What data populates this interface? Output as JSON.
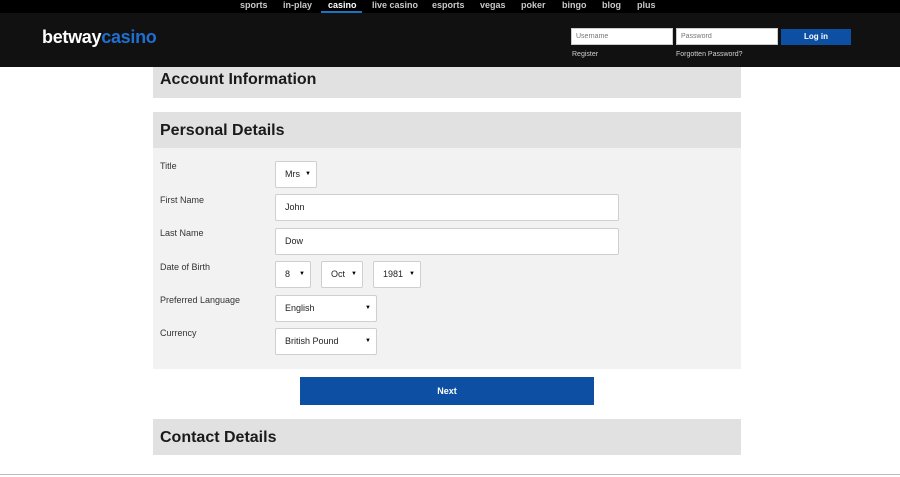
{
  "nav": {
    "items": [
      {
        "label": "sports",
        "active": false
      },
      {
        "label": "in-play",
        "active": false
      },
      {
        "label": "casino",
        "active": true
      },
      {
        "label": "live casino",
        "active": false
      },
      {
        "label": "esports",
        "active": false
      },
      {
        "label": "vegas",
        "active": false
      },
      {
        "label": "poker",
        "active": false
      },
      {
        "label": "bingo",
        "active": false
      },
      {
        "label": "blog",
        "active": false
      },
      {
        "label": "plus",
        "active": false
      }
    ]
  },
  "header": {
    "logo_part1": "betway",
    "logo_part2": "casino",
    "username_placeholder": "Username",
    "password_placeholder": "Password",
    "login_label": "Log in",
    "register_label": "Register",
    "forgotten_label": "Forgotten Password?"
  },
  "sections": {
    "account": "Account Information",
    "personal": "Personal Details",
    "contact": "Contact Details"
  },
  "form": {
    "title": {
      "label": "Title",
      "value": "Mrs"
    },
    "first_name": {
      "label": "First Name",
      "value": "John"
    },
    "last_name": {
      "label": "Last Name",
      "value": "Dow"
    },
    "dob": {
      "label": "Date of Birth",
      "day": "8",
      "month": "Oct",
      "year": "1981"
    },
    "language": {
      "label": "Preferred Language",
      "value": "English"
    },
    "currency": {
      "label": "Currency",
      "value": "British Pound"
    }
  },
  "next_label": "Next",
  "colors": {
    "accent": "#0d50a3",
    "logo_blue": "#1f6fd1",
    "header_bg": "#111111",
    "section_bg": "#e1e1e1",
    "panel_bg": "#f2f2f2"
  }
}
